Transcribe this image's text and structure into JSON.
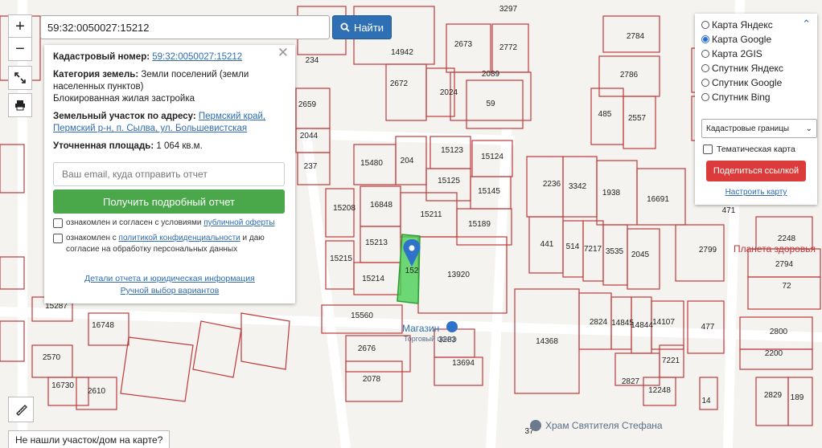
{
  "search": {
    "value": "59:32:0050027:15212",
    "button_label": "Найти"
  },
  "controls": {
    "zoom_in": "+",
    "zoom_out": "−"
  },
  "info": {
    "cadastral_label": "Кадастровый номер:",
    "cadastral_value": "59:32:0050027:15212",
    "category_label": "Категория земель:",
    "category_value": "Земли поселений (земли населенных пунктов)",
    "use_value": "Блокированная жилая застройка",
    "address_label": "Земельный участок по адресу:",
    "address_value": "Пермский край, Пермский р-н, п. Сылва, ул. Большевистская",
    "area_label": "Уточненная площадь:",
    "area_value": "1 064 кв.м.",
    "email_placeholder": "Ваш email, куда отправить отчет",
    "report_button": "Получить подробный отчет",
    "consent1_text": "ознакомлен и согласен с условиями ",
    "consent1_link": "публичной оферты",
    "consent2_text": "ознакомлен с ",
    "consent2_link": "политикой конфиденциальности",
    "consent2_tail": " и даю согласие на обработку персональных данных",
    "details_link": "Детали отчета и юридическая информация",
    "manual_link": "Ручной выбор вариантов"
  },
  "layers": {
    "options": [
      "Карта Яндекс",
      "Карта Google",
      "Карта 2GIS",
      "Спутник Яндекс",
      "Спутник Google",
      "Спутник Bing"
    ],
    "selected": "Карта Google",
    "select_value": "Кадастровые границы",
    "thematic": "Тематическая карта",
    "share": "Поделиться ссылкой",
    "setup": "Настроить карту"
  },
  "map": {
    "plots": [
      "3297",
      "2673",
      "2772",
      "234",
      "14942",
      "2784",
      "2786",
      "2089",
      "2672",
      "2024",
      "59",
      "485",
      "2557",
      "2659",
      "2044",
      "237",
      "15480",
      "204",
      "15123",
      "15124",
      "15125",
      "15145",
      "16848",
      "15208",
      "15211",
      "15189",
      "15213",
      "15215",
      "15214",
      "13920",
      "2236",
      "3342",
      "1938",
      "16691",
      "441",
      "514",
      "7217",
      "3535",
      "2045",
      "2799",
      "2248",
      "2794",
      "72",
      "471",
      "15287",
      "15560",
      "16748",
      "2676",
      "3283",
      "13694",
      "2570",
      "16730",
      "2610",
      "2078",
      "14368",
      "2824",
      "14845",
      "14844",
      "14107",
      "477",
      "2800",
      "2200",
      "7221",
      "2827",
      "12248",
      "14",
      "2829",
      "189",
      "37",
      "152"
    ],
    "poi_shop": "Магазин",
    "poi_mall": "Торговый центр",
    "poi_health": "Планета здоровья",
    "poi_church": "Храм Святителя Стефана"
  },
  "not_found": "Не нашли участок/дом на карте?"
}
